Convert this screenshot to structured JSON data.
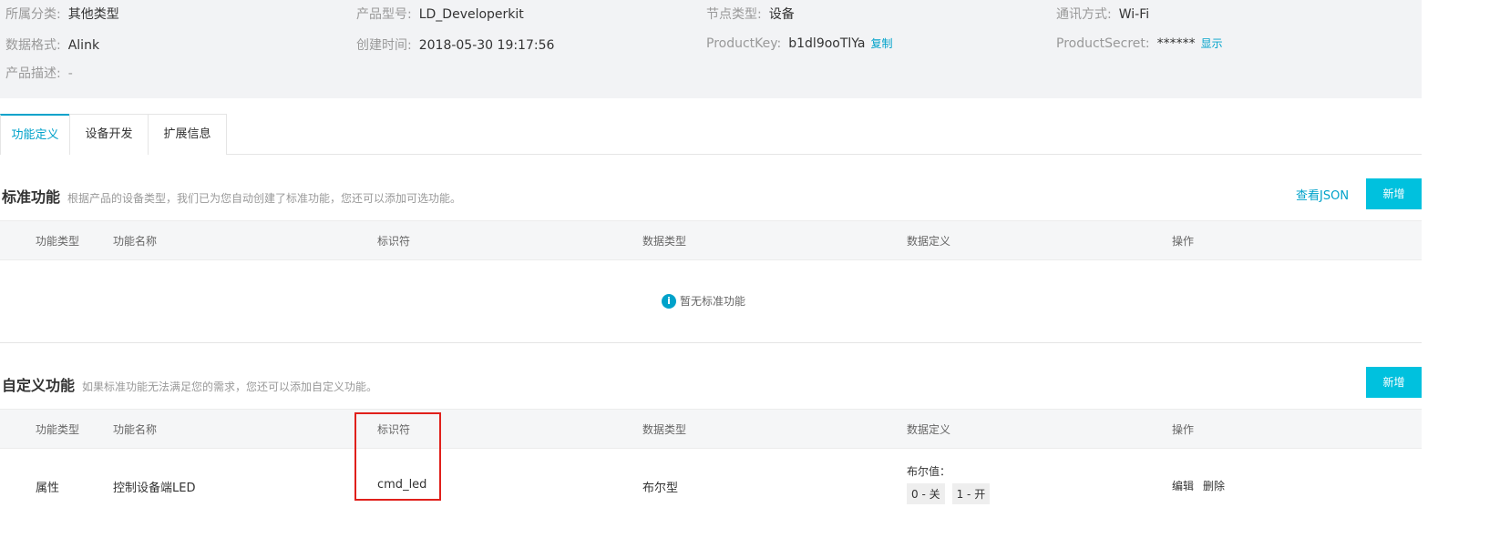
{
  "product_info": {
    "category_label": "所属分类:",
    "category_value": "其他类型",
    "model_label": "产品型号:",
    "model_value": "LD_Developerkit",
    "node_label": "节点类型:",
    "node_value": "设备",
    "comm_label": "通讯方式:",
    "comm_value": "Wi-Fi",
    "format_label": "数据格式:",
    "format_value": "Alink",
    "created_label": "创建时间:",
    "created_value": "2018-05-30 19:17:56",
    "key_label": "ProductKey:",
    "key_value": "b1dl9ooTlYa",
    "copy_link": "复制",
    "secret_label": "ProductSecret:",
    "secret_value": "******",
    "show_link": "显示",
    "desc_label": "产品描述:",
    "desc_value": "-"
  },
  "tabs": [
    "功能定义",
    "设备开发",
    "扩展信息"
  ],
  "standard": {
    "title": "标准功能",
    "desc": "根据产品的设备类型，我们已为您自动创建了标准功能，您还可以添加可选功能。",
    "view_json": "查看JSON",
    "add_button": "新增",
    "empty_text": "暂无标准功能"
  },
  "custom": {
    "title": "自定义功能",
    "desc": "如果标准功能无法满足您的需求，您还可以添加自定义功能。",
    "add_button": "新增"
  },
  "columns": [
    "功能类型",
    "功能名称",
    "标识符",
    "数据类型",
    "数据定义",
    "操作"
  ],
  "rows": [
    {
      "type": "属性",
      "name": "控制设备端LED",
      "identifier": "cmd_led",
      "data_type": "布尔型",
      "definition_label": "布尔值：",
      "definition_tags": [
        "0 - 关",
        "1 - 开"
      ],
      "edit": "编辑",
      "delete": "删除"
    }
  ],
  "colors": {
    "accent": "#00a2ca",
    "button": "#00c1de",
    "highlight": "#e0201b"
  }
}
